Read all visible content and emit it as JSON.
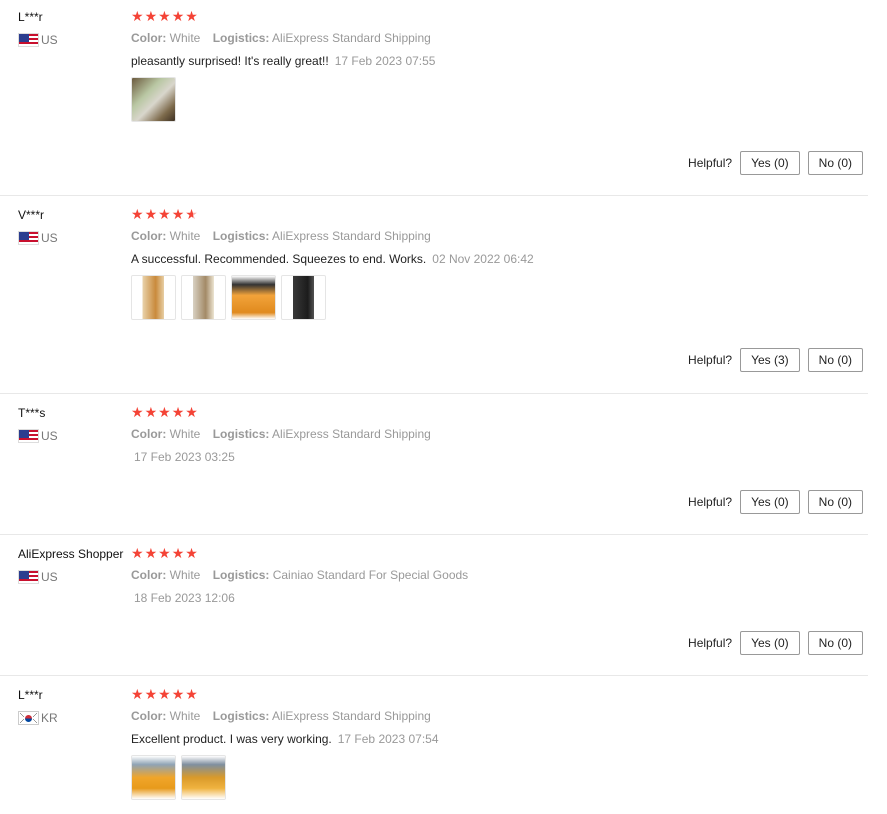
{
  "reviews": [
    {
      "user": "L***r",
      "country": "US",
      "rating": 5,
      "color_label": "Color:",
      "color_value": "White",
      "logistics_label": "Logistics:",
      "logistics_value": "AliExpress Standard Shipping",
      "text": "pleasantly surprised! It's really great!!",
      "date": "17 Feb 2023 07:55",
      "photos": [
        "review-photo-box"
      ],
      "helpful_label": "Helpful?",
      "yes": "Yes (0)",
      "no": "No (0)"
    },
    {
      "user": "V***r",
      "country": "US",
      "rating": 4.5,
      "color_label": "Color:",
      "color_value": "White",
      "logistics_label": "Logistics:",
      "logistics_value": "AliExpress Standard Shipping",
      "text": "A successful. Recommended. Squeezes to end. Works.",
      "date": "02 Nov 2022 06:42",
      "photos": [
        "review-photo-blender-orange",
        "review-photo-blender-label",
        "review-photo-blender-juice",
        "review-photo-blender-dark"
      ],
      "helpful_label": "Helpful?",
      "yes": "Yes (3)",
      "no": "No (0)"
    },
    {
      "user": "T***s",
      "country": "US",
      "rating": 5,
      "color_label": "Color:",
      "color_value": "White",
      "logistics_label": "Logistics:",
      "logistics_value": "AliExpress Standard Shipping",
      "text": "",
      "date": "17 Feb 2023 03:25",
      "photos": [],
      "helpful_label": "Helpful?",
      "yes": "Yes (0)",
      "no": "No (0)"
    },
    {
      "user": "AliExpress Shopper",
      "country": "US",
      "rating": 5,
      "color_label": "Color:",
      "color_value": "White",
      "logistics_label": "Logistics:",
      "logistics_value": "Cainiao Standard For Special Goods",
      "text": "",
      "date": "18 Feb 2023 12:06",
      "photos": [],
      "helpful_label": "Helpful?",
      "yes": "Yes (0)",
      "no": "No (0)"
    },
    {
      "user": "L***r",
      "country": "KR",
      "rating": 5,
      "color_label": "Color:",
      "color_value": "White",
      "logistics_label": "Logistics:",
      "logistics_value": "AliExpress Standard Shipping",
      "text": "Excellent product. I was very working.",
      "date": "17 Feb 2023 07:54",
      "photos": [
        "review-photo-oranges-1",
        "review-photo-oranges-2"
      ],
      "helpful_label": "",
      "yes": "",
      "no": ""
    }
  ],
  "colors": {
    "star": "#f44336",
    "muted": "#999999",
    "border": "#e8e8e8"
  }
}
